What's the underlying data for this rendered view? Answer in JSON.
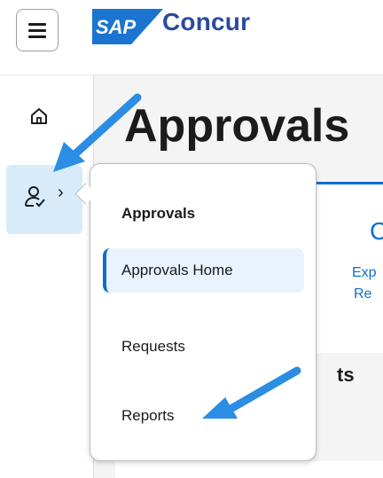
{
  "header": {
    "menu_icon": "hamburger-menu-icon",
    "logo_text": "SAP",
    "brand_name": "Concur"
  },
  "nav": {
    "home_icon": "home-icon",
    "approvals_icon": "user-check-icon",
    "expand_chevron": "›"
  },
  "main": {
    "page_title": "Approvals",
    "card_count": "C",
    "card_label_line1": "Exp",
    "card_label_line2": "Re",
    "section_title_partial": "ts"
  },
  "popover": {
    "title": "Approvals",
    "items": [
      {
        "label": "Approvals Home",
        "active": true
      },
      {
        "label": "Requests",
        "active": false
      },
      {
        "label": "Reports",
        "active": false
      }
    ]
  },
  "colors": {
    "accent": "#0a6ed1",
    "nav_active_bg": "#d7ebfb",
    "annotation_arrow": "#2b8de3"
  }
}
